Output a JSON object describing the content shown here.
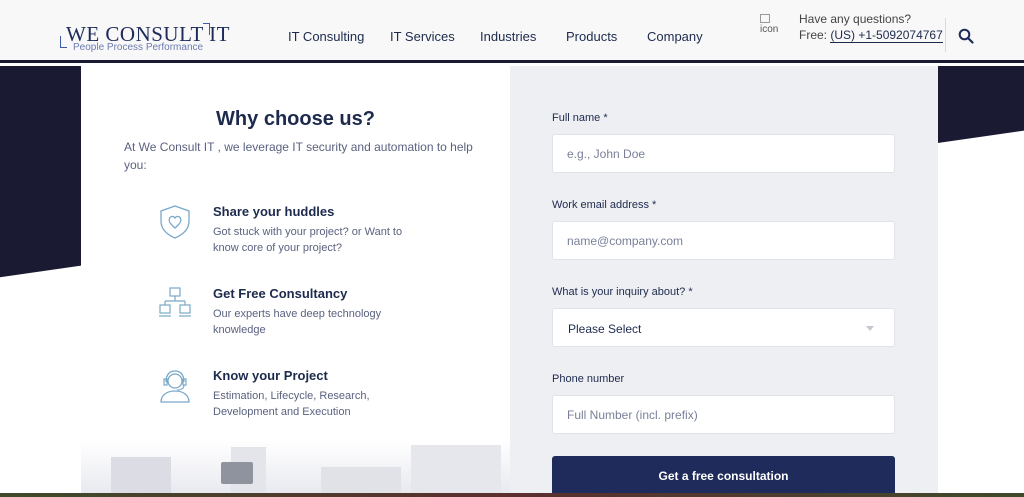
{
  "header": {
    "logo_main": "WE CONSULT IT",
    "logo_sub": "People Process Performance",
    "nav": [
      {
        "label": "IT Consulting"
      },
      {
        "label": "IT Services"
      },
      {
        "label": "Industries"
      },
      {
        "label": "Products"
      },
      {
        "label": "Company"
      }
    ],
    "icon_alt": "icon",
    "question": "Have any questions?",
    "free_label": "Free:",
    "phone": "(US) +1-5092074767"
  },
  "why": {
    "title": "Why choose us?",
    "description": "At We Consult IT , we leverage IT security and automation to help you:",
    "features": [
      {
        "icon": "shield-heart-icon",
        "title": "Share your huddles",
        "desc": "Got stuck with your project? or Want to know core of your project?"
      },
      {
        "icon": "network-computers-icon",
        "title": "Get Free Consultancy",
        "desc": "Our experts have deep technology knowledge"
      },
      {
        "icon": "support-agent-icon",
        "title": "Know your Project",
        "desc": "Estimation, Lifecycle, Research, Development and Execution"
      }
    ]
  },
  "form": {
    "full_name_label": "Full name *",
    "full_name_placeholder": "e.g., John Doe",
    "email_label": "Work email address *",
    "email_placeholder": "name@company.com",
    "inquiry_label": "What is your inquiry about? *",
    "inquiry_value": "Please Select",
    "phone_label": "Phone number",
    "phone_placeholder": "Full Number (incl. prefix)",
    "submit_label": "Get a free consultation"
  },
  "colors": {
    "navy": "#1f2b5a",
    "dark_band": "#1b1a33",
    "form_bg": "#eeeff3"
  }
}
